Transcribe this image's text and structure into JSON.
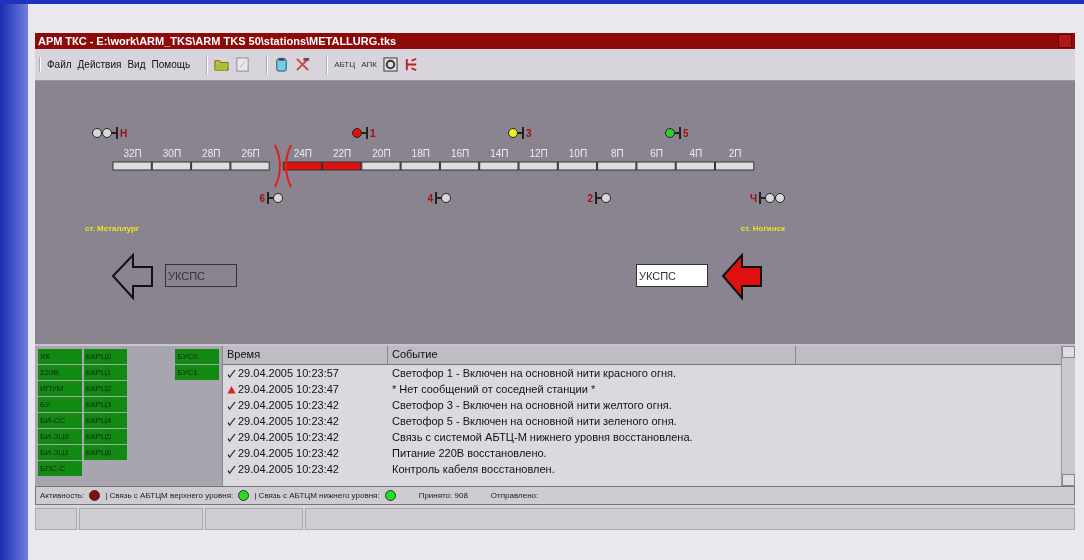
{
  "window": {
    "title": "АРМ ТКС - E:\\work\\ARM_TKS\\ARM TKS 50\\stations\\METALLURG.tks"
  },
  "menu": [
    "Файл",
    "Действия",
    "Вид",
    "Помощь"
  ],
  "toolbar_labels": [
    "АБТЦ",
    "АПК"
  ],
  "track": {
    "segments": [
      {
        "label": "32П",
        "occupied": false
      },
      {
        "label": "30П",
        "occupied": false
      },
      {
        "label": "28П",
        "occupied": false
      },
      {
        "label": "26П",
        "occupied": false
      },
      {
        "label": "24П",
        "occupied": true
      },
      {
        "label": "22П",
        "occupied": true
      },
      {
        "label": "20П",
        "occupied": false
      },
      {
        "label": "18П",
        "occupied": false
      },
      {
        "label": "16П",
        "occupied": false
      },
      {
        "label": "14П",
        "occupied": false
      },
      {
        "label": "12П",
        "occupied": false
      },
      {
        "label": "10П",
        "occupied": false
      },
      {
        "label": "8П",
        "occupied": false
      },
      {
        "label": "6П",
        "occupied": false
      },
      {
        "label": "4П",
        "occupied": false
      },
      {
        "label": "2П",
        "occupied": false
      }
    ],
    "signals": [
      {
        "label": "Н",
        "kind": "top",
        "lamps": [
          {
            "color": "#d8d8d8"
          },
          {
            "color": "#d8d8d8"
          }
        ]
      },
      {
        "label": "1",
        "kind": "top",
        "lamps": [
          {
            "color": "#e01010"
          }
        ]
      },
      {
        "label": "3",
        "kind": "top",
        "lamps": [
          {
            "color": "#f0f020"
          }
        ]
      },
      {
        "label": "5",
        "kind": "top",
        "lamps": [
          {
            "color": "#30d030"
          }
        ]
      },
      {
        "label": "6",
        "kind": "bottom",
        "lamps": [
          {
            "color": "#d8d8d8"
          }
        ]
      },
      {
        "label": "4",
        "kind": "bottom",
        "lamps": [
          {
            "color": "#d8d8d8"
          }
        ]
      },
      {
        "label": "2",
        "kind": "bottom",
        "lamps": [
          {
            "color": "#d8d8d8"
          }
        ]
      },
      {
        "label": "Ч",
        "kind": "bottom",
        "lamps": [
          {
            "color": "#d8d8d8"
          },
          {
            "color": "#d8d8d8"
          }
        ]
      }
    ]
  },
  "stations": [
    "ст. Металлург",
    "ст. Ногинск"
  ],
  "directions": [
    {
      "label": "УКСПС",
      "active": false
    },
    {
      "label": "УКСПС",
      "active": true
    }
  ],
  "devices": [
    [
      {
        "label": "ХК",
        "ok": true
      },
      {
        "label": "220В",
        "ok": true
      },
      {
        "label": "ИПУМ",
        "ok": true
      },
      {
        "label": "БУ",
        "ok": true
      },
      {
        "label": "БИ-СС",
        "ok": true
      },
      {
        "label": "БИ-ЗЦ0",
        "ok": true
      },
      {
        "label": "БИ-ЗЦ1",
        "ok": true
      },
      {
        "label": "БПС-С",
        "ok": true
      }
    ],
    [
      {
        "label": "БКРЦ0",
        "ok": true
      },
      {
        "label": "БКРЦ1",
        "ok": true
      },
      {
        "label": "БКРЦ2",
        "ok": true
      },
      {
        "label": "БКРЦ3",
        "ok": true
      },
      {
        "label": "БКРЦ4",
        "ok": true
      },
      {
        "label": "БКРЦ5",
        "ok": true
      },
      {
        "label": "БКРЦ6",
        "ok": true
      }
    ],
    [
      {
        "label": "БУС0",
        "ok": true
      },
      {
        "label": "БУС1",
        "ok": true
      }
    ]
  ],
  "log": {
    "columns": [
      "Время",
      "Событие"
    ],
    "rows": [
      {
        "kind": "ok",
        "time": "29.04.2005 10:23:57",
        "event": "Светофор 1 - Включен на основной нити красного огня."
      },
      {
        "kind": "warning",
        "time": "29.04.2005 10:23:47",
        "event": "* Нет сообщений от соседней станции *"
      },
      {
        "kind": "ok",
        "time": "29.04.2005 10:23:42",
        "event": "Светофор 3 - Включен на основной нити желтого огня."
      },
      {
        "kind": "ok",
        "time": "29.04.2005 10:23:42",
        "event": "Светофор 5 - Включен на основной нити зеленого огня."
      },
      {
        "kind": "ok",
        "time": "29.04.2005 10:23:42",
        "event": "Связь с системой АБТЦ-М нижнего уровня восстановлена."
      },
      {
        "kind": "ok",
        "time": "29.04.2005 10:23:42",
        "event": "Питание 220В восстановлено."
      },
      {
        "kind": "ok",
        "time": "29.04.2005 10:23:42",
        "event": "Контроль кабеля восстановлен."
      }
    ]
  },
  "status_bar": {
    "indicators": [
      {
        "label": "Активность:",
        "color": "#8a0a0a"
      },
      {
        "label": "| Связь с АБТЦМ верхнего уровня:",
        "color": "#20e020"
      },
      {
        "label": "| Связь с АБТЦМ нижнего уровня:",
        "color": "#20e020"
      }
    ],
    "received": "Принято: 908",
    "sent": "Отправлено:"
  }
}
